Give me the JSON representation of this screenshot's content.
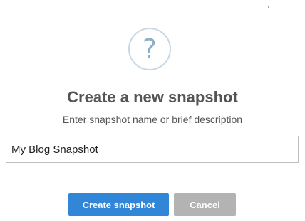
{
  "dialog": {
    "icon": "question-icon",
    "icon_glyph": "?",
    "title": "Create a new snapshot",
    "subtitle": "Enter snapshot name or brief description",
    "name_field_value": "My Blog Snapshot",
    "create_label": "Create snapshot",
    "cancel_label": "Cancel"
  },
  "colors": {
    "primary_button": "#3286d8",
    "secondary_button": "#b3b3b3",
    "icon_ring": "#c7d8e4",
    "icon_glyph": "#8fb0c6",
    "title_text": "#545454"
  }
}
